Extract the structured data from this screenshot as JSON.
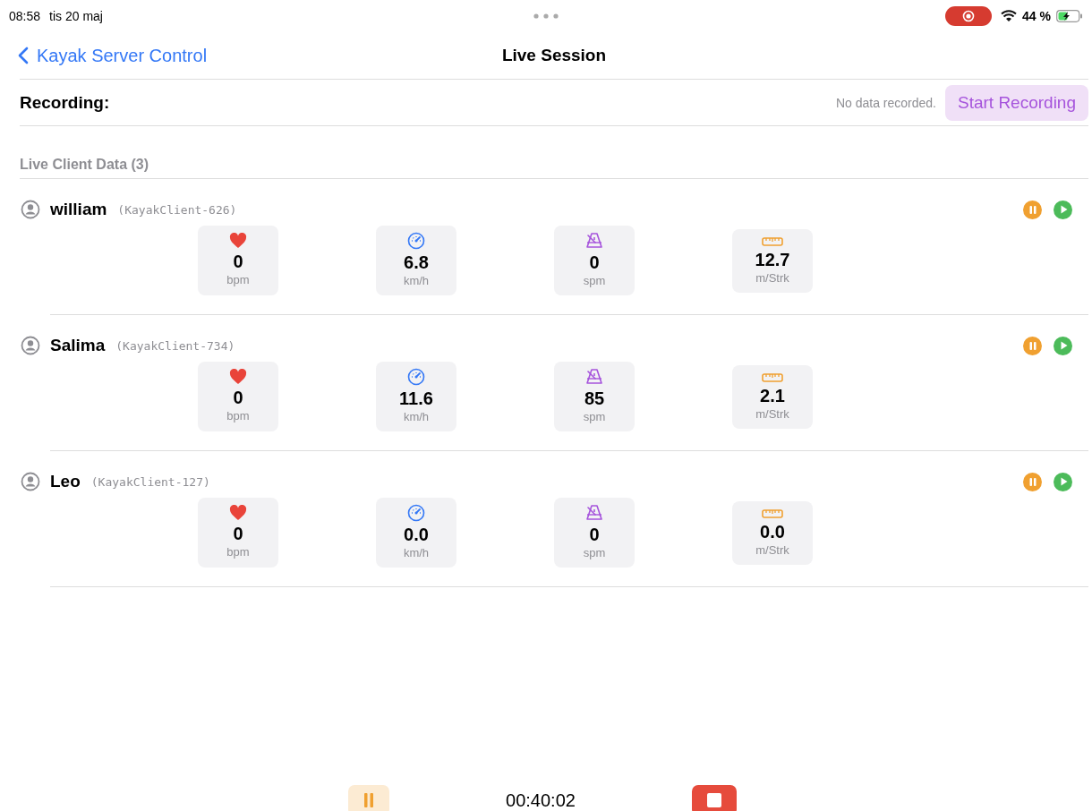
{
  "status_bar": {
    "time": "08:58",
    "date": "tis 20 maj",
    "battery": "44 %",
    "screen_recording": true,
    "charging": true
  },
  "nav": {
    "back": "Kayak Server Control",
    "title": "Live Session"
  },
  "recording": {
    "label": "Recording:",
    "status": "No data recorded.",
    "button": "Start Recording"
  },
  "section": {
    "title": "Live Client Data (3)"
  },
  "clients": [
    {
      "name": "william",
      "device": "(KayakClient-626)",
      "metrics": [
        {
          "kind": "heart",
          "value": "0",
          "unit": "bpm"
        },
        {
          "kind": "speed",
          "value": "6.8",
          "unit": "km/h"
        },
        {
          "kind": "cadence",
          "value": "0",
          "unit": "spm"
        },
        {
          "kind": "distance",
          "value": "12.7",
          "unit": "m/Strk"
        }
      ]
    },
    {
      "name": "Salima",
      "device": "(KayakClient-734)",
      "metrics": [
        {
          "kind": "heart",
          "value": "0",
          "unit": "bpm"
        },
        {
          "kind": "speed",
          "value": "11.6",
          "unit": "km/h"
        },
        {
          "kind": "cadence",
          "value": "85",
          "unit": "spm"
        },
        {
          "kind": "distance",
          "value": "2.1",
          "unit": "m/Strk"
        }
      ]
    },
    {
      "name": "Leo",
      "device": "(KayakClient-127)",
      "metrics": [
        {
          "kind": "heart",
          "value": "0",
          "unit": "bpm"
        },
        {
          "kind": "speed",
          "value": "0.0",
          "unit": "km/h"
        },
        {
          "kind": "cadence",
          "value": "0",
          "unit": "spm"
        },
        {
          "kind": "distance",
          "value": "0.0",
          "unit": "m/Strk"
        }
      ]
    }
  ],
  "session": {
    "timer": "00:40:02"
  }
}
